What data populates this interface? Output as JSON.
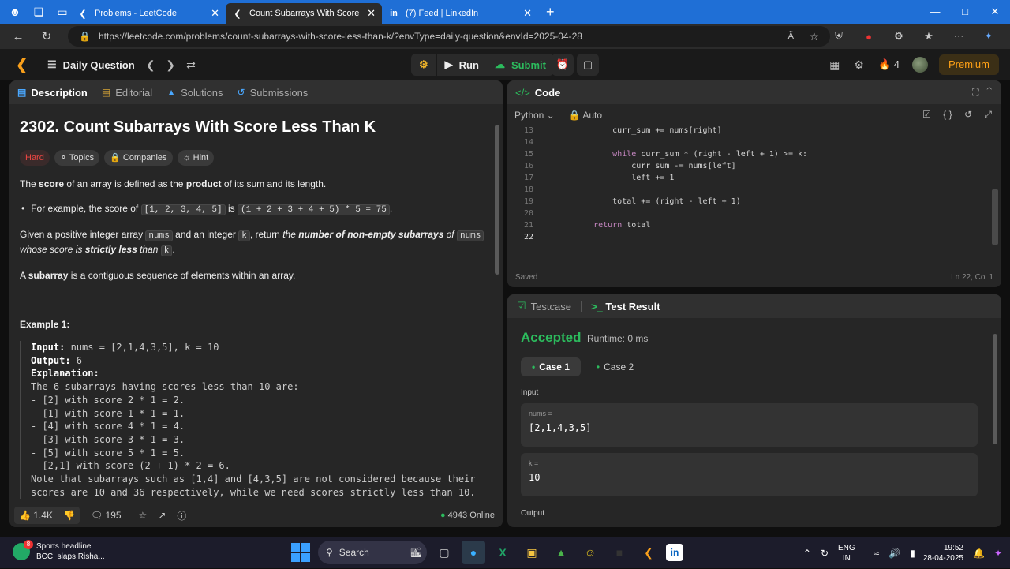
{
  "browser": {
    "tabs": [
      {
        "title": "Problems - LeetCode",
        "active": false
      },
      {
        "title": "Count Subarrays With Score Less",
        "active": true
      },
      {
        "title": "(7) Feed | LinkedIn",
        "active": false
      }
    ],
    "url": "https://leetcode.com/problems/count-subarrays-with-score-less-than-k/?envType=daily-question&envId=2025-04-28",
    "read_aloud": "Ã"
  },
  "lcnav": {
    "daily_question": "Daily Question",
    "run": "Run",
    "submit": "Submit",
    "streak": "4",
    "premium": "Premium"
  },
  "left": {
    "tabs": [
      "Description",
      "Editorial",
      "Solutions",
      "Submissions"
    ],
    "title": "2302. Count Subarrays With Score Less Than K",
    "tags": [
      "Hard",
      "Topics",
      "Companies",
      "Hint"
    ],
    "p1": {
      "a": "The ",
      "b": "score",
      "c": " of an array is defined as the ",
      "d": "product",
      "e": " of its sum and its length."
    },
    "bullet": {
      "a": "For example, the score of ",
      "code1": "[1, 2, 3, 4, 5]",
      "b": " is ",
      "code2": "(1 + 2 + 3 + 4 + 5) * 5 = 75",
      "c": "."
    },
    "p2": {
      "a": "Given a positive integer array ",
      "code1": "nums",
      "b": " and an integer ",
      "code2": "k",
      "c": ", return ",
      "d": "the ",
      "e": "number of non-empty subarrays",
      "f": " of ",
      "code3": "nums",
      "g": "whose score is ",
      "h": "strictly less",
      "i": " than ",
      "code4": "k",
      "j": "."
    },
    "p3": {
      "a": "A ",
      "b": "subarray",
      "c": " is a contiguous sequence of elements within an array."
    },
    "example_title": "Example 1:",
    "example": {
      "input_label": "Input:",
      "input": " nums = [2,1,4,3,5], k = 10",
      "output_label": "Output:",
      "output": " 6",
      "expl_label": "Explanation:",
      "lines": [
        "The 6 subarrays having scores less than 10 are:",
        "- [2] with score 2 * 1 = 2.",
        "- [1] with score 1 * 1 = 1.",
        "- [4] with score 4 * 1 = 4.",
        "- [3] with score 3 * 1 = 3.",
        "- [5] with score 5 * 1 = 5.",
        "- [2,1] with score (2 + 1) * 2 = 6.",
        "Note that subarrays such as [1,4] and [4,3,5] are not considered because their",
        "scores are 10 and 36 respectively, while we need scores strictly less than 10."
      ]
    },
    "likes": "1.4K",
    "comments": "195",
    "online": "4943 Online"
  },
  "code": {
    "title": "Code",
    "language": "Python",
    "auto": "Auto",
    "lines": [
      {
        "n": "13",
        "t": "        curr_sum += nums[right]"
      },
      {
        "n": "14",
        "t": ""
      },
      {
        "n": "15",
        "t": "        while curr_sum * (right - left + 1) >= k:"
      },
      {
        "n": "16",
        "t": "            curr_sum -= nums[left]"
      },
      {
        "n": "17",
        "t": "            left += 1"
      },
      {
        "n": "18",
        "t": ""
      },
      {
        "n": "19",
        "t": "        total += (right - left + 1)"
      },
      {
        "n": "20",
        "t": ""
      },
      {
        "n": "21",
        "t": "    return total"
      },
      {
        "n": "22",
        "t": ""
      }
    ],
    "saved": "Saved",
    "position": "Ln 22, Col 1"
  },
  "test": {
    "tab_testcase": "Testcase",
    "tab_result": "Test Result",
    "status": "Accepted",
    "runtime": "Runtime: 0 ms",
    "cases": [
      "Case 1",
      "Case 2"
    ],
    "input_label": "Input",
    "param1_name": "nums =",
    "param1_value": "[2,1,4,3,5]",
    "param2_name": "k =",
    "param2_value": "10",
    "output_label": "Output"
  },
  "taskbar": {
    "news_title": "Sports headline",
    "news_sub": "BCCI slaps Risha...",
    "news_badge": "8",
    "search": "Search",
    "lang1": "ENG",
    "lang2": "IN",
    "time": "19:52",
    "date": "28-04-2025"
  }
}
